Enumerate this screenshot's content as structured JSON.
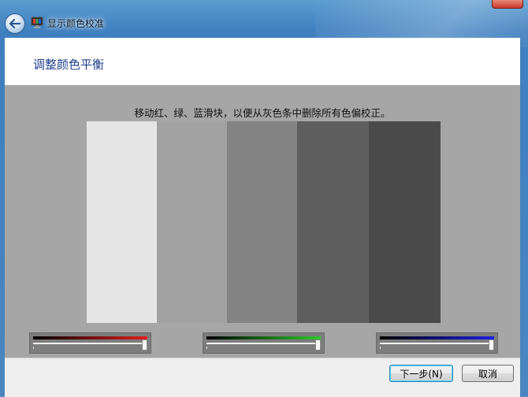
{
  "window": {
    "title": "显示颜色校准",
    "icons": {
      "back": "back-arrow-icon",
      "app": "display-calibration-icon"
    }
  },
  "page": {
    "heading": "调整颜色平衡",
    "instruction": "移动红、绿、蓝滑块，以便从灰色条中删除所有色偏校正。"
  },
  "gray_bars": [
    {
      "color": "#e5e5e5"
    },
    {
      "color": "#a2a2a2"
    },
    {
      "color": "#838383"
    },
    {
      "color": "#5e5e5e"
    },
    {
      "color": "#4a4a4a"
    }
  ],
  "sliders": [
    {
      "channel": "red",
      "accent": "#e01e1e",
      "value_percent": 100
    },
    {
      "channel": "green",
      "accent": "#2ec82e",
      "value_percent": 100
    },
    {
      "channel": "blue",
      "accent": "#1e1ee0",
      "value_percent": 100
    }
  ],
  "buttons": {
    "next": "下一步(N)",
    "cancel": "取消"
  }
}
